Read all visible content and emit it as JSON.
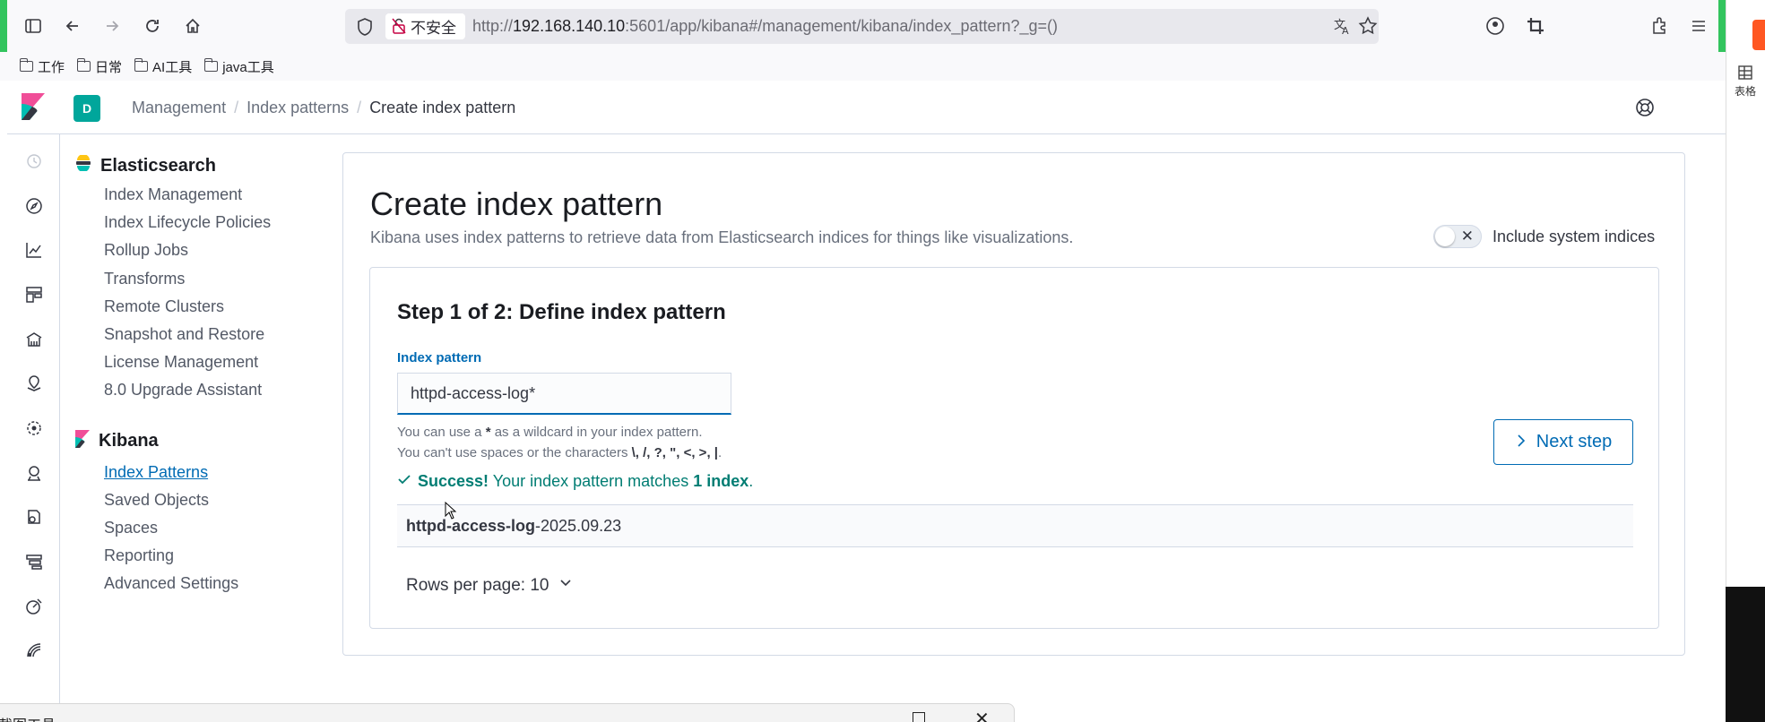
{
  "browser": {
    "insecure_label": "不安全",
    "url_prefix": "http://",
    "url_host": "192.168.140.10",
    "url_rest": ":5601/app/kibana#/management/kibana/index_pattern?_g=()",
    "bookmarks": [
      {
        "label": "工作"
      },
      {
        "label": "日常"
      },
      {
        "label": "AI工具"
      },
      {
        "label": "java工具"
      }
    ]
  },
  "right_panel": {
    "table_label": "表格"
  },
  "header": {
    "space_initial": "D",
    "breadcrumbs": [
      "Management",
      "Index patterns",
      "Create index pattern"
    ],
    "separator": "/"
  },
  "sidebar": {
    "elasticsearch": {
      "title": "Elasticsearch",
      "items": [
        "Index Management",
        "Index Lifecycle Policies",
        "Rollup Jobs",
        "Transforms",
        "Remote Clusters",
        "Snapshot and Restore",
        "License Management",
        "8.0 Upgrade Assistant"
      ]
    },
    "kibana": {
      "title": "Kibana",
      "items": [
        "Index Patterns",
        "Saved Objects",
        "Spaces",
        "Reporting",
        "Advanced Settings"
      ],
      "active_index": 0
    }
  },
  "main": {
    "title": "Create index pattern",
    "description": "Kibana uses index patterns to retrieve data from Elasticsearch indices for things like visualizations.",
    "include_system_label": "Include system indices",
    "include_system_on": false,
    "step": {
      "title": "Step 1 of 2: Define index pattern",
      "field_label": "Index pattern",
      "field_value": "httpd-access-log*",
      "help_line1_prefix": "You can use a ",
      "help_line1_star": "*",
      "help_line1_suffix": " as a wildcard in your index pattern.",
      "help_line2_prefix": "You can't use spaces or the characters ",
      "help_line2_chars": "\\, /, ?, \", <, >, |",
      "help_line2_suffix": ".",
      "success_strong": "Success!",
      "success_text": " Your index pattern matches ",
      "success_count": "1 index",
      "success_end": ".",
      "result_match": "httpd-access-log",
      "result_rest": "-2025.09.23",
      "rows_per_page": "Rows per page: 10",
      "next_label": "Next step"
    }
  },
  "snip_window": {
    "title": "截图工具"
  },
  "colors": {
    "accent": "#006bb4",
    "success": "#017d73",
    "space": "#00a69b",
    "browser_accent": "#33c45e"
  }
}
